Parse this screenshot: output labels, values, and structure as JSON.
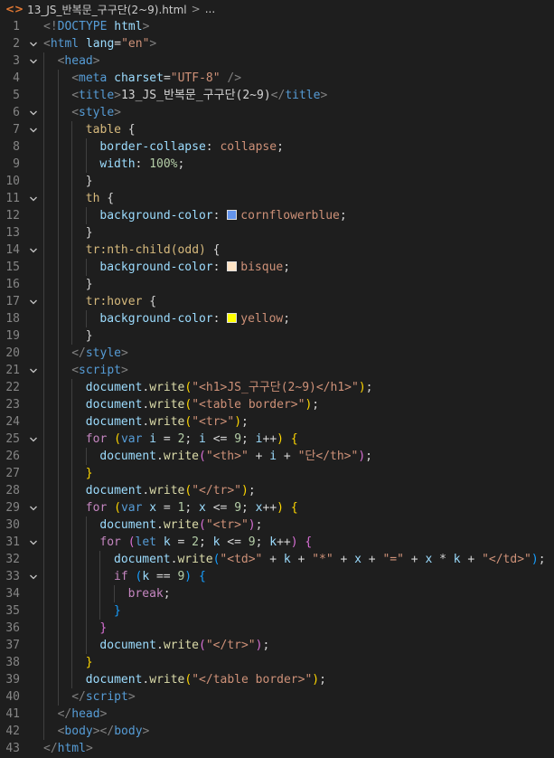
{
  "breadcrumb": {
    "file_icon": "<>",
    "file_name": "13_JS_반복문_구구단(2~9).html",
    "separator": ">",
    "ellipsis": "..."
  },
  "colors": {
    "cornflowerblue": "#6495ed",
    "bisque": "#ffe4c4",
    "yellow": "#ffff00"
  },
  "lines": [
    {
      "n": "1",
      "fold": false,
      "indent": 0,
      "tokens": [
        [
          "punct",
          "<!"
        ],
        [
          "tag",
          "DOCTYPE"
        ],
        [
          "text",
          " "
        ],
        [
          "attr",
          "html"
        ],
        [
          "punct",
          ">"
        ]
      ]
    },
    {
      "n": "2",
      "fold": true,
      "indent": 0,
      "tokens": [
        [
          "punct",
          "<"
        ],
        [
          "tag",
          "html"
        ],
        [
          "text",
          " "
        ],
        [
          "attr",
          "lang"
        ],
        [
          "text",
          "="
        ],
        [
          "str",
          "\"en\""
        ],
        [
          "punct",
          ">"
        ]
      ]
    },
    {
      "n": "3",
      "fold": true,
      "indent": 1,
      "tokens": [
        [
          "punct",
          "<"
        ],
        [
          "tag",
          "head"
        ],
        [
          "punct",
          ">"
        ]
      ]
    },
    {
      "n": "4",
      "fold": false,
      "indent": 2,
      "tokens": [
        [
          "punct",
          "<"
        ],
        [
          "tag",
          "meta"
        ],
        [
          "text",
          " "
        ],
        [
          "attr",
          "charset"
        ],
        [
          "text",
          "="
        ],
        [
          "str",
          "\"UTF-8\""
        ],
        [
          "text",
          " "
        ],
        [
          "punct",
          "/>"
        ]
      ]
    },
    {
      "n": "5",
      "fold": false,
      "indent": 2,
      "tokens": [
        [
          "punct",
          "<"
        ],
        [
          "tag",
          "title"
        ],
        [
          "punct",
          ">"
        ],
        [
          "text",
          "13_JS_반복문_구구단(2~9)"
        ],
        [
          "punct",
          "</"
        ],
        [
          "tag",
          "title"
        ],
        [
          "punct",
          ">"
        ]
      ]
    },
    {
      "n": "6",
      "fold": true,
      "indent": 2,
      "tokens": [
        [
          "punct",
          "<"
        ],
        [
          "tag",
          "style"
        ],
        [
          "punct",
          ">"
        ]
      ]
    },
    {
      "n": "7",
      "fold": true,
      "indent": 3,
      "tokens": [
        [
          "sel",
          "table"
        ],
        [
          "text",
          " {"
        ]
      ]
    },
    {
      "n": "8",
      "fold": false,
      "indent": 4,
      "tokens": [
        [
          "prop",
          "border-collapse"
        ],
        [
          "text",
          ": "
        ],
        [
          "val",
          "collapse"
        ],
        [
          "text",
          ";"
        ]
      ]
    },
    {
      "n": "9",
      "fold": false,
      "indent": 4,
      "tokens": [
        [
          "prop",
          "width"
        ],
        [
          "text",
          ": "
        ],
        [
          "num",
          "100%"
        ],
        [
          "text",
          ";"
        ]
      ]
    },
    {
      "n": "10",
      "fold": false,
      "indent": 3,
      "tokens": [
        [
          "text",
          "}"
        ]
      ]
    },
    {
      "n": "11",
      "fold": true,
      "indent": 3,
      "tokens": [
        [
          "sel",
          "th"
        ],
        [
          "text",
          " {"
        ]
      ]
    },
    {
      "n": "12",
      "fold": false,
      "indent": 4,
      "tokens": [
        [
          "prop",
          "background-color"
        ],
        [
          "text",
          ": "
        ],
        [
          "swatch",
          "cornflowerblue"
        ],
        [
          "val",
          "cornflowerblue"
        ],
        [
          "text",
          ";"
        ]
      ]
    },
    {
      "n": "13",
      "fold": false,
      "indent": 3,
      "tokens": [
        [
          "text",
          "}"
        ]
      ]
    },
    {
      "n": "14",
      "fold": true,
      "indent": 3,
      "tokens": [
        [
          "sel",
          "tr:nth-child(odd)"
        ],
        [
          "text",
          " {"
        ]
      ]
    },
    {
      "n": "15",
      "fold": false,
      "indent": 4,
      "tokens": [
        [
          "prop",
          "background-color"
        ],
        [
          "text",
          ": "
        ],
        [
          "swatch",
          "bisque"
        ],
        [
          "val",
          "bisque"
        ],
        [
          "text",
          ";"
        ]
      ]
    },
    {
      "n": "16",
      "fold": false,
      "indent": 3,
      "tokens": [
        [
          "text",
          "}"
        ]
      ]
    },
    {
      "n": "17",
      "fold": true,
      "indent": 3,
      "tokens": [
        [
          "sel",
          "tr:hover"
        ],
        [
          "text",
          " {"
        ]
      ]
    },
    {
      "n": "18",
      "fold": false,
      "indent": 4,
      "tokens": [
        [
          "prop",
          "background-color"
        ],
        [
          "text",
          ": "
        ],
        [
          "swatch",
          "yellow"
        ],
        [
          "val",
          "yellow"
        ],
        [
          "text",
          ";"
        ]
      ]
    },
    {
      "n": "19",
      "fold": false,
      "indent": 3,
      "tokens": [
        [
          "text",
          "}"
        ]
      ]
    },
    {
      "n": "20",
      "fold": false,
      "indent": 2,
      "tokens": [
        [
          "punct",
          "</"
        ],
        [
          "tag",
          "style"
        ],
        [
          "punct",
          ">"
        ]
      ]
    },
    {
      "n": "21",
      "fold": true,
      "indent": 2,
      "tokens": [
        [
          "punct",
          "<"
        ],
        [
          "tag",
          "script"
        ],
        [
          "punct",
          ">"
        ]
      ]
    },
    {
      "n": "22",
      "fold": false,
      "indent": 3,
      "tokens": [
        [
          "var",
          "document"
        ],
        [
          "text",
          "."
        ],
        [
          "fn",
          "write"
        ],
        [
          "b1",
          "("
        ],
        [
          "str",
          "\"<h1>JS_구구단(2~9)</h1>\""
        ],
        [
          "b1",
          ")"
        ],
        [
          "text",
          ";"
        ]
      ]
    },
    {
      "n": "23",
      "fold": false,
      "indent": 3,
      "tokens": [
        [
          "var",
          "document"
        ],
        [
          "text",
          "."
        ],
        [
          "fn",
          "write"
        ],
        [
          "b1",
          "("
        ],
        [
          "str",
          "\"<table border>\""
        ],
        [
          "b1",
          ")"
        ],
        [
          "text",
          ";"
        ]
      ]
    },
    {
      "n": "24",
      "fold": false,
      "indent": 3,
      "tokens": [
        [
          "var",
          "document"
        ],
        [
          "text",
          "."
        ],
        [
          "fn",
          "write"
        ],
        [
          "b1",
          "("
        ],
        [
          "str",
          "\"<tr>\""
        ],
        [
          "b1",
          ")"
        ],
        [
          "text",
          ";"
        ]
      ]
    },
    {
      "n": "25",
      "fold": true,
      "indent": 3,
      "tokens": [
        [
          "kw",
          "for"
        ],
        [
          "text",
          " "
        ],
        [
          "b1",
          "("
        ],
        [
          "storage",
          "var"
        ],
        [
          "text",
          " "
        ],
        [
          "var",
          "i"
        ],
        [
          "text",
          " = "
        ],
        [
          "num",
          "2"
        ],
        [
          "text",
          "; "
        ],
        [
          "var",
          "i"
        ],
        [
          "text",
          " <= "
        ],
        [
          "num",
          "9"
        ],
        [
          "text",
          "; "
        ],
        [
          "var",
          "i"
        ],
        [
          "text",
          "++"
        ],
        [
          "b1",
          ")"
        ],
        [
          "text",
          " "
        ],
        [
          "b1",
          "{"
        ]
      ]
    },
    {
      "n": "26",
      "fold": false,
      "indent": 4,
      "tokens": [
        [
          "var",
          "document"
        ],
        [
          "text",
          "."
        ],
        [
          "fn",
          "write"
        ],
        [
          "b2",
          "("
        ],
        [
          "str",
          "\"<th>\""
        ],
        [
          "text",
          " + "
        ],
        [
          "var",
          "i"
        ],
        [
          "text",
          " + "
        ],
        [
          "str",
          "\"단</th>\""
        ],
        [
          "b2",
          ")"
        ],
        [
          "text",
          ";"
        ]
      ]
    },
    {
      "n": "27",
      "fold": false,
      "indent": 3,
      "tokens": [
        [
          "b1",
          "}"
        ]
      ]
    },
    {
      "n": "28",
      "fold": false,
      "indent": 3,
      "tokens": [
        [
          "var",
          "document"
        ],
        [
          "text",
          "."
        ],
        [
          "fn",
          "write"
        ],
        [
          "b1",
          "("
        ],
        [
          "str",
          "\"</tr>\""
        ],
        [
          "b1",
          ")"
        ],
        [
          "text",
          ";"
        ]
      ]
    },
    {
      "n": "29",
      "fold": true,
      "indent": 3,
      "tokens": [
        [
          "kw",
          "for"
        ],
        [
          "text",
          " "
        ],
        [
          "b1",
          "("
        ],
        [
          "storage",
          "var"
        ],
        [
          "text",
          " "
        ],
        [
          "var",
          "x"
        ],
        [
          "text",
          " = "
        ],
        [
          "num",
          "1"
        ],
        [
          "text",
          "; "
        ],
        [
          "var",
          "x"
        ],
        [
          "text",
          " <= "
        ],
        [
          "num",
          "9"
        ],
        [
          "text",
          "; "
        ],
        [
          "var",
          "x"
        ],
        [
          "text",
          "++"
        ],
        [
          "b1",
          ")"
        ],
        [
          "text",
          " "
        ],
        [
          "b1",
          "{"
        ]
      ]
    },
    {
      "n": "30",
      "fold": false,
      "indent": 4,
      "tokens": [
        [
          "var",
          "document"
        ],
        [
          "text",
          "."
        ],
        [
          "fn",
          "write"
        ],
        [
          "b2",
          "("
        ],
        [
          "str",
          "\"<tr>\""
        ],
        [
          "b2",
          ")"
        ],
        [
          "text",
          ";"
        ]
      ]
    },
    {
      "n": "31",
      "fold": true,
      "indent": 4,
      "tokens": [
        [
          "kw",
          "for"
        ],
        [
          "text",
          " "
        ],
        [
          "b2",
          "("
        ],
        [
          "storage",
          "let"
        ],
        [
          "text",
          " "
        ],
        [
          "var",
          "k"
        ],
        [
          "text",
          " = "
        ],
        [
          "num",
          "2"
        ],
        [
          "text",
          "; "
        ],
        [
          "var",
          "k"
        ],
        [
          "text",
          " <= "
        ],
        [
          "num",
          "9"
        ],
        [
          "text",
          "; "
        ],
        [
          "var",
          "k"
        ],
        [
          "text",
          "++"
        ],
        [
          "b2",
          ")"
        ],
        [
          "text",
          " "
        ],
        [
          "b2",
          "{"
        ]
      ]
    },
    {
      "n": "32",
      "fold": false,
      "indent": 5,
      "tokens": [
        [
          "var",
          "document"
        ],
        [
          "text",
          "."
        ],
        [
          "fn",
          "write"
        ],
        [
          "b3",
          "("
        ],
        [
          "str",
          "\"<td>\""
        ],
        [
          "text",
          " + "
        ],
        [
          "var",
          "k"
        ],
        [
          "text",
          " + "
        ],
        [
          "str",
          "\"*\""
        ],
        [
          "text",
          " + "
        ],
        [
          "var",
          "x"
        ],
        [
          "text",
          " + "
        ],
        [
          "str",
          "\"=\""
        ],
        [
          "text",
          " + "
        ],
        [
          "var",
          "x"
        ],
        [
          "text",
          " * "
        ],
        [
          "var",
          "k"
        ],
        [
          "text",
          " + "
        ],
        [
          "str",
          "\"</td>\""
        ],
        [
          "b3",
          ")"
        ],
        [
          "text",
          ";"
        ]
      ]
    },
    {
      "n": "33",
      "fold": true,
      "indent": 5,
      "tokens": [
        [
          "kw",
          "if"
        ],
        [
          "text",
          " "
        ],
        [
          "b3",
          "("
        ],
        [
          "var",
          "k"
        ],
        [
          "text",
          " == "
        ],
        [
          "num",
          "9"
        ],
        [
          "b3",
          ")"
        ],
        [
          "text",
          " "
        ],
        [
          "b3",
          "{"
        ]
      ]
    },
    {
      "n": "34",
      "fold": false,
      "indent": 6,
      "tokens": [
        [
          "kw",
          "break"
        ],
        [
          "text",
          ";"
        ]
      ]
    },
    {
      "n": "35",
      "fold": false,
      "indent": 5,
      "tokens": [
        [
          "b3",
          "}"
        ]
      ]
    },
    {
      "n": "36",
      "fold": false,
      "indent": 4,
      "tokens": [
        [
          "b2",
          "}"
        ]
      ]
    },
    {
      "n": "37",
      "fold": false,
      "indent": 4,
      "tokens": [
        [
          "var",
          "document"
        ],
        [
          "text",
          "."
        ],
        [
          "fn",
          "write"
        ],
        [
          "b2",
          "("
        ],
        [
          "str",
          "\"</tr>\""
        ],
        [
          "b2",
          ")"
        ],
        [
          "text",
          ";"
        ]
      ]
    },
    {
      "n": "38",
      "fold": false,
      "indent": 3,
      "tokens": [
        [
          "b1",
          "}"
        ]
      ]
    },
    {
      "n": "39",
      "fold": false,
      "indent": 3,
      "tokens": [
        [
          "var",
          "document"
        ],
        [
          "text",
          "."
        ],
        [
          "fn",
          "write"
        ],
        [
          "b1",
          "("
        ],
        [
          "str",
          "\"</table border>\""
        ],
        [
          "b1",
          ")"
        ],
        [
          "text",
          ";"
        ]
      ]
    },
    {
      "n": "40",
      "fold": false,
      "indent": 2,
      "tokens": [
        [
          "punct",
          "</"
        ],
        [
          "tag",
          "script"
        ],
        [
          "punct",
          ">"
        ]
      ]
    },
    {
      "n": "41",
      "fold": false,
      "indent": 1,
      "tokens": [
        [
          "punct",
          "</"
        ],
        [
          "tag",
          "head"
        ],
        [
          "punct",
          ">"
        ]
      ]
    },
    {
      "n": "42",
      "fold": false,
      "indent": 1,
      "tokens": [
        [
          "punct",
          "<"
        ],
        [
          "tag",
          "body"
        ],
        [
          "punct",
          "></"
        ],
        [
          "tag",
          "body"
        ],
        [
          "punct",
          ">"
        ]
      ]
    },
    {
      "n": "43",
      "fold": false,
      "indent": 0,
      "tokens": [
        [
          "punct",
          "</"
        ],
        [
          "tag",
          "html"
        ],
        [
          "punct",
          ">"
        ]
      ]
    }
  ]
}
